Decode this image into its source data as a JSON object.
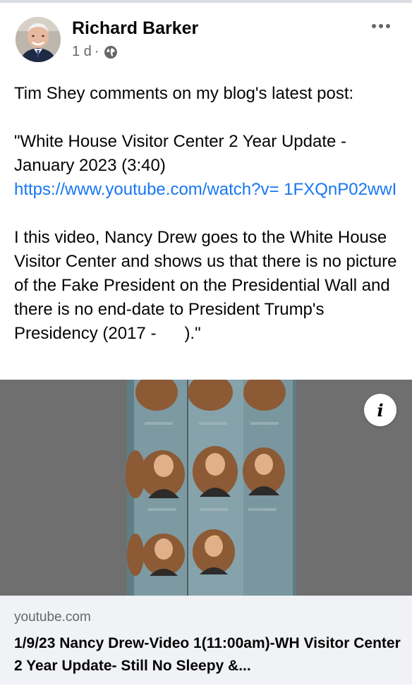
{
  "post": {
    "author": "Richard Barker",
    "time": "1 d",
    "separator": "·",
    "audience_icon": "globe-icon",
    "more_icon": "more-options-icon",
    "text_line1": "Tim Shey comments on my blog's latest post:",
    "text_quote1": "\"White House Visitor Center 2 Year Update - January 2023 (3:40)",
    "link": "https://www.youtube.com/watch?v= 1FXQnP02wwI",
    "text_quote2": "I this video, Nancy Drew goes to the White House Visitor Center and shows us that there is no picture of the Fake President on the Presidential Wall and there is no end-date to President Trump's Presidency (2017 -      ).\""
  },
  "media": {
    "info_icon": "i"
  },
  "link_card": {
    "domain": "youtube.com",
    "title": "1/9/23 Nancy Drew-Video 1(11:00am)-WH Visitor Center 2 Year Update- Still No Sleepy &..."
  },
  "colors": {
    "link": "#1877f2",
    "secondary_text": "#65676b",
    "card_bg": "#f0f2f5"
  }
}
